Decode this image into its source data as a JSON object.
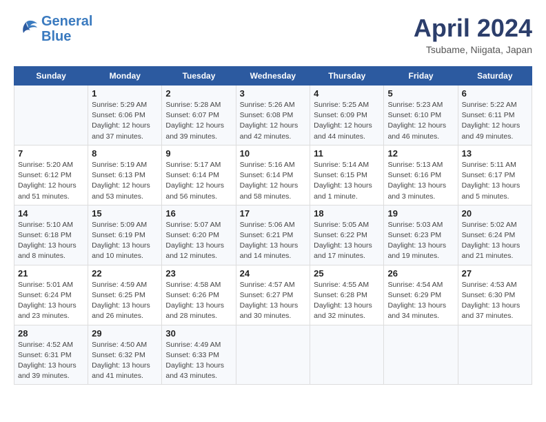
{
  "header": {
    "logo_line1": "General",
    "logo_line2": "Blue",
    "month": "April 2024",
    "location": "Tsubame, Niigata, Japan"
  },
  "days_of_week": [
    "Sunday",
    "Monday",
    "Tuesday",
    "Wednesday",
    "Thursday",
    "Friday",
    "Saturday"
  ],
  "weeks": [
    [
      {
        "day": "",
        "info": ""
      },
      {
        "day": "1",
        "info": "Sunrise: 5:29 AM\nSunset: 6:06 PM\nDaylight: 12 hours\nand 37 minutes."
      },
      {
        "day": "2",
        "info": "Sunrise: 5:28 AM\nSunset: 6:07 PM\nDaylight: 12 hours\nand 39 minutes."
      },
      {
        "day": "3",
        "info": "Sunrise: 5:26 AM\nSunset: 6:08 PM\nDaylight: 12 hours\nand 42 minutes."
      },
      {
        "day": "4",
        "info": "Sunrise: 5:25 AM\nSunset: 6:09 PM\nDaylight: 12 hours\nand 44 minutes."
      },
      {
        "day": "5",
        "info": "Sunrise: 5:23 AM\nSunset: 6:10 PM\nDaylight: 12 hours\nand 46 minutes."
      },
      {
        "day": "6",
        "info": "Sunrise: 5:22 AM\nSunset: 6:11 PM\nDaylight: 12 hours\nand 49 minutes."
      }
    ],
    [
      {
        "day": "7",
        "info": "Sunrise: 5:20 AM\nSunset: 6:12 PM\nDaylight: 12 hours\nand 51 minutes."
      },
      {
        "day": "8",
        "info": "Sunrise: 5:19 AM\nSunset: 6:13 PM\nDaylight: 12 hours\nand 53 minutes."
      },
      {
        "day": "9",
        "info": "Sunrise: 5:17 AM\nSunset: 6:14 PM\nDaylight: 12 hours\nand 56 minutes."
      },
      {
        "day": "10",
        "info": "Sunrise: 5:16 AM\nSunset: 6:14 PM\nDaylight: 12 hours\nand 58 minutes."
      },
      {
        "day": "11",
        "info": "Sunrise: 5:14 AM\nSunset: 6:15 PM\nDaylight: 13 hours\nand 1 minute."
      },
      {
        "day": "12",
        "info": "Sunrise: 5:13 AM\nSunset: 6:16 PM\nDaylight: 13 hours\nand 3 minutes."
      },
      {
        "day": "13",
        "info": "Sunrise: 5:11 AM\nSunset: 6:17 PM\nDaylight: 13 hours\nand 5 minutes."
      }
    ],
    [
      {
        "day": "14",
        "info": "Sunrise: 5:10 AM\nSunset: 6:18 PM\nDaylight: 13 hours\nand 8 minutes."
      },
      {
        "day": "15",
        "info": "Sunrise: 5:09 AM\nSunset: 6:19 PM\nDaylight: 13 hours\nand 10 minutes."
      },
      {
        "day": "16",
        "info": "Sunrise: 5:07 AM\nSunset: 6:20 PM\nDaylight: 13 hours\nand 12 minutes."
      },
      {
        "day": "17",
        "info": "Sunrise: 5:06 AM\nSunset: 6:21 PM\nDaylight: 13 hours\nand 14 minutes."
      },
      {
        "day": "18",
        "info": "Sunrise: 5:05 AM\nSunset: 6:22 PM\nDaylight: 13 hours\nand 17 minutes."
      },
      {
        "day": "19",
        "info": "Sunrise: 5:03 AM\nSunset: 6:23 PM\nDaylight: 13 hours\nand 19 minutes."
      },
      {
        "day": "20",
        "info": "Sunrise: 5:02 AM\nSunset: 6:24 PM\nDaylight: 13 hours\nand 21 minutes."
      }
    ],
    [
      {
        "day": "21",
        "info": "Sunrise: 5:01 AM\nSunset: 6:24 PM\nDaylight: 13 hours\nand 23 minutes."
      },
      {
        "day": "22",
        "info": "Sunrise: 4:59 AM\nSunset: 6:25 PM\nDaylight: 13 hours\nand 26 minutes."
      },
      {
        "day": "23",
        "info": "Sunrise: 4:58 AM\nSunset: 6:26 PM\nDaylight: 13 hours\nand 28 minutes."
      },
      {
        "day": "24",
        "info": "Sunrise: 4:57 AM\nSunset: 6:27 PM\nDaylight: 13 hours\nand 30 minutes."
      },
      {
        "day": "25",
        "info": "Sunrise: 4:55 AM\nSunset: 6:28 PM\nDaylight: 13 hours\nand 32 minutes."
      },
      {
        "day": "26",
        "info": "Sunrise: 4:54 AM\nSunset: 6:29 PM\nDaylight: 13 hours\nand 34 minutes."
      },
      {
        "day": "27",
        "info": "Sunrise: 4:53 AM\nSunset: 6:30 PM\nDaylight: 13 hours\nand 37 minutes."
      }
    ],
    [
      {
        "day": "28",
        "info": "Sunrise: 4:52 AM\nSunset: 6:31 PM\nDaylight: 13 hours\nand 39 minutes."
      },
      {
        "day": "29",
        "info": "Sunrise: 4:50 AM\nSunset: 6:32 PM\nDaylight: 13 hours\nand 41 minutes."
      },
      {
        "day": "30",
        "info": "Sunrise: 4:49 AM\nSunset: 6:33 PM\nDaylight: 13 hours\nand 43 minutes."
      },
      {
        "day": "",
        "info": ""
      },
      {
        "day": "",
        "info": ""
      },
      {
        "day": "",
        "info": ""
      },
      {
        "day": "",
        "info": ""
      }
    ]
  ]
}
